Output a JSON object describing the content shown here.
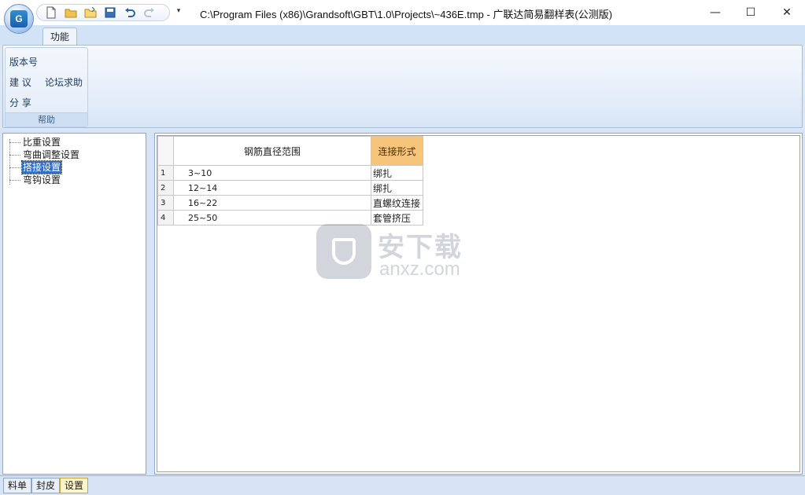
{
  "window": {
    "title": "C:\\Program Files (x86)\\Grandsoft\\GBT\\1.0\\Projects\\~436E.tmp - 广联达简易翻样表(公测版)",
    "controls": {
      "minimize": "—",
      "maximize": "☐",
      "close": "✕"
    }
  },
  "app_button": {
    "logo_text": "G"
  },
  "quick_access": {
    "icons": [
      "new-file-icon",
      "open-folder-icon",
      "open-recent-icon",
      "save-icon",
      "undo-icon",
      "redo-icon"
    ],
    "dropdown": "▾"
  },
  "ribbon": {
    "tabs": [
      {
        "label": "功能"
      }
    ],
    "group": {
      "label": "帮助",
      "buttons": {
        "version": "版本号",
        "suggest": "建 议",
        "forum": "论坛求助",
        "share": "分 享"
      }
    }
  },
  "tree": {
    "items": [
      {
        "label": "比重设置",
        "selected": false
      },
      {
        "label": "弯曲调整设置",
        "selected": false
      },
      {
        "label": "搭接设置",
        "selected": true
      },
      {
        "label": "弯钩设置",
        "selected": false
      }
    ]
  },
  "grid": {
    "columns": [
      "钢筋直径范围",
      "连接形式"
    ],
    "rows": [
      {
        "num": "1",
        "range": "3~10",
        "type": "绑扎"
      },
      {
        "num": "2",
        "range": "12~14",
        "type": "绑扎"
      },
      {
        "num": "3",
        "range": "16~22",
        "type": "直螺纹连接"
      },
      {
        "num": "4",
        "range": "25~50",
        "type": "套管挤压"
      }
    ],
    "header_accent_color": "#f6c47b"
  },
  "watermark": {
    "title": "安下载",
    "subtitle": "anxz.com"
  },
  "bottom_tabs": [
    {
      "label": "料单",
      "active": false
    },
    {
      "label": "封皮",
      "active": false
    },
    {
      "label": "设置",
      "active": true
    }
  ]
}
